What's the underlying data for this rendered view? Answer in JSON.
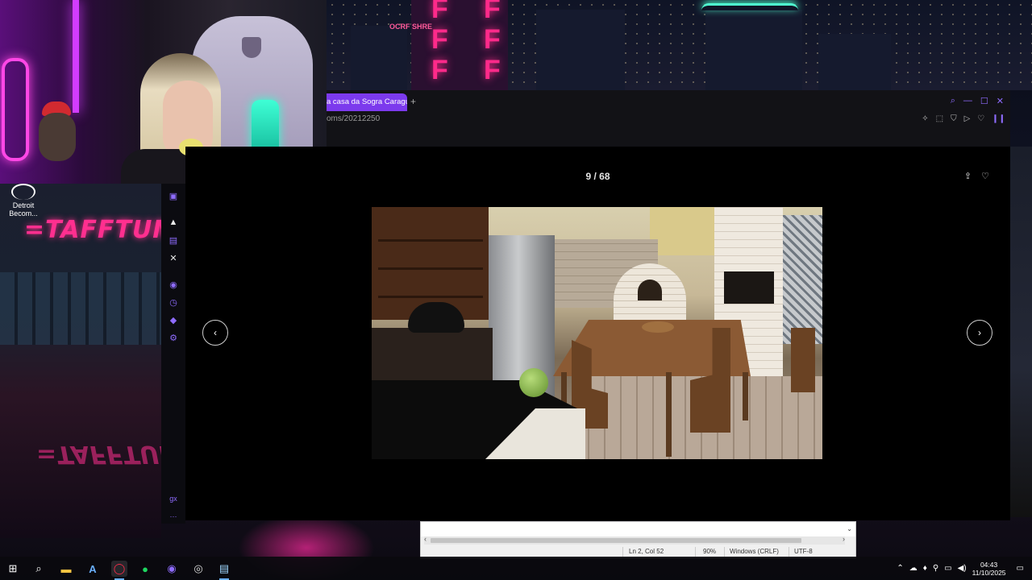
{
  "desktop": {
    "icon_label_1": "Detroit",
    "icon_label_2": "Becom..."
  },
  "wallpaper": {
    "store_sign": "=TAFFTUN",
    "tower_letters": [
      "F",
      "F",
      "F",
      "F",
      "F",
      "F"
    ],
    "tower_sign": "OCRF SHRE"
  },
  "browser": {
    "tab_title": "a casa da Sogra Caragua",
    "new_tab_symbol": "+",
    "address": "oms/20212250",
    "window_controls": [
      "search-icon",
      "minimize-icon",
      "maximize-icon",
      "close-icon"
    ],
    "address_controls": [
      "bookmark-icon",
      "screenshot-icon",
      "shield-icon",
      "play-icon",
      "heart-icon",
      "sidebar-icon"
    ]
  },
  "viewer": {
    "counter": "9 / 68",
    "actions": [
      "share-icon",
      "heart-icon"
    ],
    "prev_symbol": "‹",
    "next_symbol": "›"
  },
  "sidebar": {
    "bottom_label": "gx",
    "more_symbol": "···"
  },
  "editor": {
    "position": "Ln 2, Col 52",
    "zoom": "90%",
    "line_endings": "Windows (CRLF)",
    "encoding": "UTF-8"
  },
  "taskbar": {
    "time": "04:43",
    "date": "11/10/2025",
    "apps": [
      "windows-start",
      "search",
      "file-explorer",
      "app-a",
      "opera-gx",
      "spotify",
      "chrome-profile",
      "app-alt",
      "notepad"
    ]
  },
  "colors": {
    "accent": "#7c3aed",
    "accent_light": "#8f6cff",
    "neon_pink": "#ff2a8a",
    "neon_teal": "#33ffd0"
  }
}
